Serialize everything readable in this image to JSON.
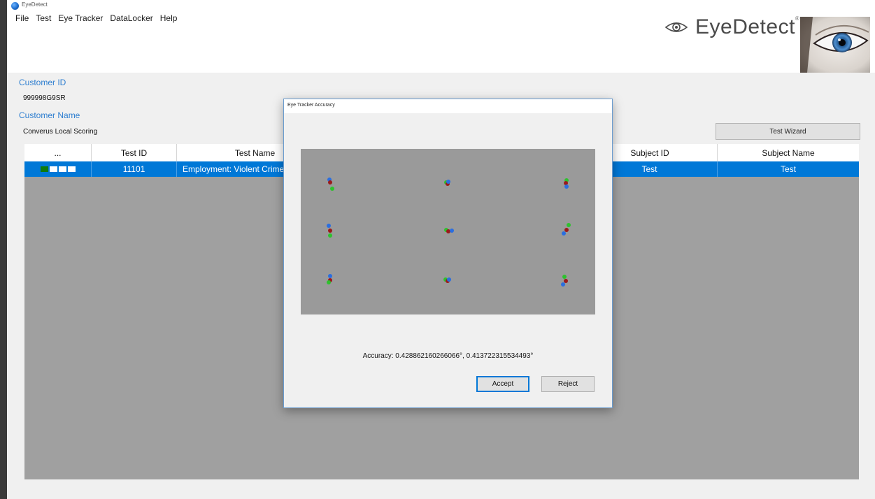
{
  "app": {
    "title": "EyeDetect"
  },
  "menu": [
    "File",
    "Test",
    "Eye Tracker",
    "DataLocker",
    "Help"
  ],
  "brand": {
    "name": "EyeDetect",
    "reg": "®"
  },
  "customer": {
    "id_label": "Customer ID",
    "id_value": "999998G9SR",
    "name_label": "Customer Name",
    "name_value": "Converus Local Scoring"
  },
  "wizard_button": "Test Wizard",
  "grid": {
    "columns": [
      "...",
      "Test ID",
      "Test Name",
      "Subject ID",
      "Subject Name"
    ],
    "rows": [
      {
        "progress_on": 1,
        "progress_total": 4,
        "test_id": "11101",
        "test_name": "Employment: Violent Crimes",
        "subject_id": "Test",
        "subject_name": "Test"
      }
    ]
  },
  "dialog": {
    "title": "Eye Tracker Accuracy",
    "accuracy": "Accuracy: 0.428862160266066°, 0.413722315534493°",
    "accept": "Accept",
    "reject": "Reject"
  },
  "colors": {
    "accent": "#0078d7",
    "label": "#2f7fd0",
    "progress": "#0e7a0e",
    "grid_bg": "#a0a0a0"
  }
}
